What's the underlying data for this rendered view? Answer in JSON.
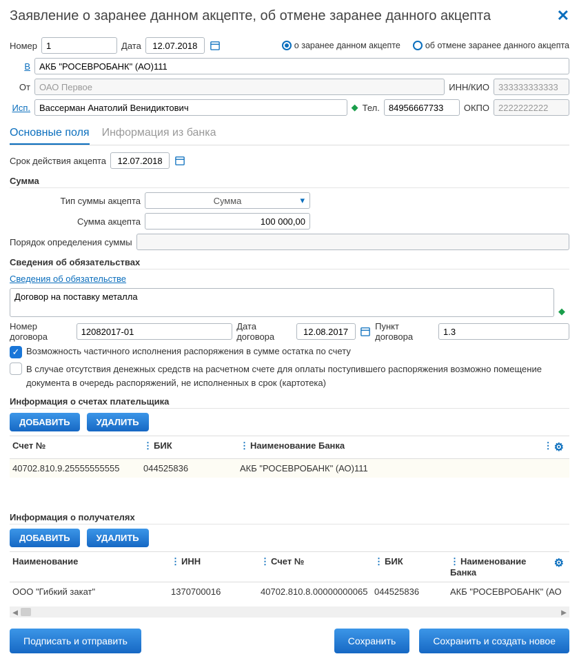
{
  "header": {
    "title": "Заявление о заранее данном акцепте, об отмене заранее данного акцепта"
  },
  "top": {
    "number_label": "Номер",
    "number": "1",
    "date_label": "Дата",
    "date": "12.07.2018",
    "radio1": "о заранее данном акцепте",
    "radio2": "об отмене заранее данного акцепта",
    "v_label": "В",
    "v_value": "АКБ \"РОСЕВРОБАНК\" (АО)111",
    "from_label": "От",
    "from_value": "ОАО Первое",
    "innkio_label": "ИНН/КИО",
    "innkio_value": "333333333333",
    "isp_label": "Исп.",
    "isp_value": "Вассерман Анатолий Венидиктович",
    "tel_label": "Тел.",
    "tel_value": "84956667733",
    "okpo_label": "ОКПО",
    "okpo_value": "2222222222"
  },
  "tabs": {
    "t1": "Основные поля",
    "t2": "Информация из банка"
  },
  "main": {
    "validity_label": "Срок действия акцепта",
    "validity": "12.07.2018",
    "sum_heading": "Сумма",
    "sum_type_label": "Тип суммы акцепта",
    "sum_type": "Сумма",
    "sum_amount_label": "Сумма акцепта",
    "sum_amount": "100 000,00",
    "order_label": "Порядок определения суммы",
    "order_value": ""
  },
  "oblig": {
    "heading": "Сведения об обязательствах",
    "link": "Сведения об обязательстве",
    "text": "Договор на поставку металла",
    "contract_num_label": "Номер договора",
    "contract_num": "12082017-01",
    "contract_date_label": "Дата договора",
    "contract_date": "12.08.2017",
    "clause_label": "Пункт договора",
    "clause": "1.3",
    "cb1": "Возможность частичного исполнения распоряжения в сумме остатка по счету",
    "cb2": "В случае отсутствия денежных средств на расчетном счете для оплаты поступившего распоряжения возможно помещение документа в очередь распоряжений, не исполненных в срок (картотека)"
  },
  "payer": {
    "heading": "Информация о счетах плательщика",
    "add": "ДОБАВИТЬ",
    "del": "УДАЛИТЬ",
    "cols": {
      "acct": "Счет №",
      "bik": "БИК",
      "bank": "Наименование Банка"
    },
    "row": {
      "acct": "40702.810.9.25555555555",
      "bik": "044525836",
      "bank": "АКБ \"РОСЕВРОБАНК\" (АО)111"
    }
  },
  "recv": {
    "heading": "Информация о получателях",
    "add": "ДОБАВИТЬ",
    "del": "УДАЛИТЬ",
    "cols": {
      "name": "Наименование",
      "inn": "ИНН",
      "acct": "Счет №",
      "bik": "БИК",
      "bank": "Наименование Банка"
    },
    "row": {
      "name": "ООО \"Гибкий закат\"",
      "inn": "1370700016",
      "acct": "40702.810.8.00000000065",
      "bik": "044525836",
      "bank": "АКБ \"РОСЕВРОБАНК\" (АО"
    }
  },
  "footer": {
    "sign": "Подписать и отправить",
    "save": "Сохранить",
    "savenew": "Сохранить и создать новое"
  }
}
